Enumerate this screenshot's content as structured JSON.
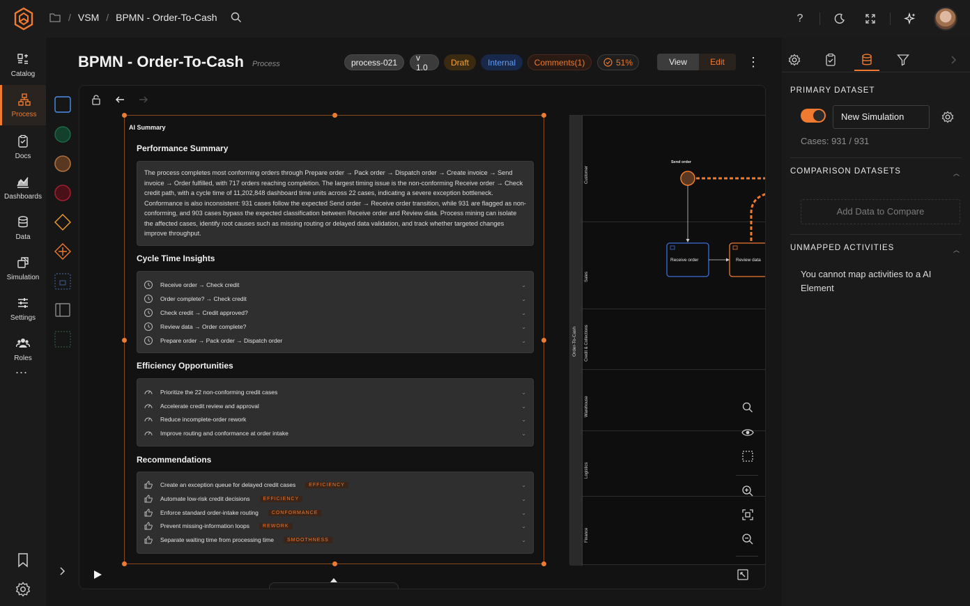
{
  "breadcrumb": {
    "item1": "VSM",
    "sep": "/",
    "item2": "BPMN - Order-To-Cash"
  },
  "nav": {
    "items": [
      {
        "label": "Catalog"
      },
      {
        "label": "Process"
      },
      {
        "label": "Docs"
      },
      {
        "label": "Dashboards"
      },
      {
        "label": "Data"
      },
      {
        "label": "Simulation"
      },
      {
        "label": "Settings"
      },
      {
        "label": "Roles"
      }
    ],
    "more": "..."
  },
  "header": {
    "title": "BPMN - Order-To-Cash",
    "subtitle": "Process",
    "id_pill": "process-021",
    "version_pill": "v 1.0",
    "status_pill": "Draft",
    "visibility_pill": "Internal",
    "comments_pill": "Comments(1)",
    "progress_pill": "51%",
    "view_label": "View",
    "edit_label": "Edit",
    "kebab": "⋮"
  },
  "summary": {
    "ai_title": "AI Summary",
    "perf_title": "Performance Summary",
    "perf_text": "The process completes most conforming orders through Prepare order → Pack order → Dispatch order → Create invoice → Send invoice → Order fulfilled, with 717 orders reaching completion. The largest timing issue is the non-conforming Receive order → Check credit path, with a cycle time of 11,202,848 dashboard time units across 22 cases, indicating a severe exception bottleneck. Conformance is also inconsistent: 931 cases follow the expected Send order → Receive order transition, while 931 are flagged as non-conforming, and 903 cases bypass the expected classification between Receive order and Review data. Process mining can isolate the affected cases, identify root causes such as missing routing or delayed data validation, and track whether targeted changes improve throughput.",
    "cycle_title": "Cycle Time Insights",
    "cycle_rows": [
      "Receive order → Check credit",
      "Order complete? → Check credit",
      "Check credit → Credit approved?",
      "Review data → Order complete?",
      "Prepare order → Pack order → Dispatch order"
    ],
    "eff_title": "Efficiency Opportunities",
    "eff_rows": [
      "Prioritize the 22 non-conforming credit cases",
      "Accelerate credit review and approval",
      "Reduce incomplete-order rework",
      "Improve routing and conformance at order intake"
    ],
    "rec_title": "Recommendations",
    "rec_rows": [
      {
        "text": "Create an exception queue for delayed credit cases",
        "tag": "EFFICIENCY"
      },
      {
        "text": "Automate low-risk credit decisions",
        "tag": "EFFICIENCY"
      },
      {
        "text": "Enforce standard order-intake routing",
        "tag": "CONFORMANCE"
      },
      {
        "text": "Prevent missing-information loops",
        "tag": "REWORK"
      },
      {
        "text": "Separate waiting time from processing time",
        "tag": "SMOOTHNESS"
      }
    ]
  },
  "diagram": {
    "pool": "Order-To-Cash",
    "lanes": [
      "Customer",
      "Sales",
      "Credit & Collections",
      "Warehouse",
      "Logistics",
      "Finance"
    ],
    "start_event": "Send order",
    "task1": "Receive order",
    "task2": "Review data"
  },
  "right": {
    "primary_title": "PRIMARY DATASET",
    "simulation_value": "New Simulation",
    "cases": "Cases: 931 / 931",
    "comparison_title": "COMPARISON DATASETS",
    "add_compare": "Add Data to Compare",
    "unmapped_title": "UNMAPPED ACTIVITIES",
    "unmapped_text": "You cannot map activities to a AI Element"
  },
  "colors": {
    "accent": "#f07a2f",
    "blue": "#5d9cff"
  }
}
